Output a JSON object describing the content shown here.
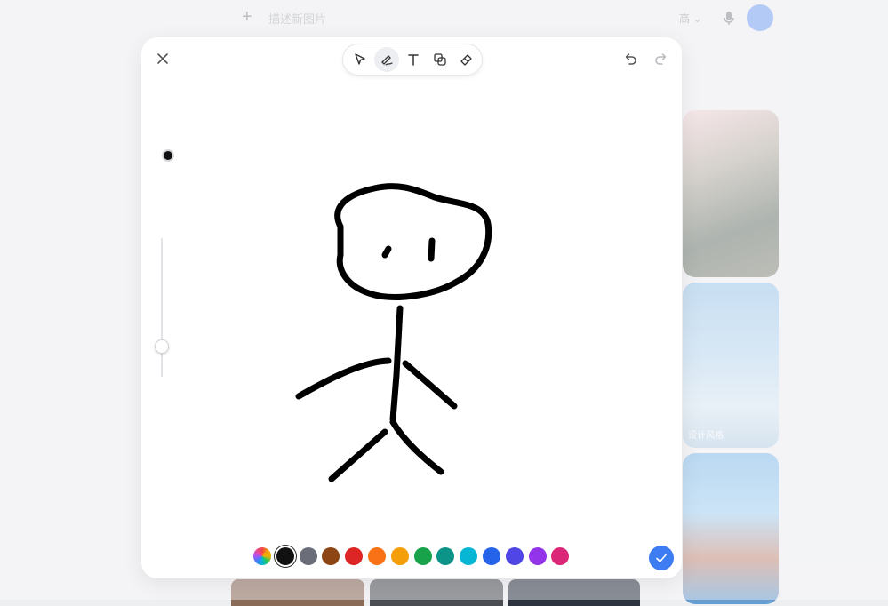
{
  "topbar": {
    "prompt_placeholder": "描述新图片",
    "quality_label": "高",
    "plus_icon": "plus-icon",
    "mic_icon": "microphone-icon",
    "send_icon": "send-icon"
  },
  "gallery": {
    "card2_caption": "设计风格"
  },
  "modal": {
    "tools": [
      {
        "name": "select",
        "icon": "cursor-icon",
        "active": false
      },
      {
        "name": "pen",
        "icon": "pen-icon",
        "active": true
      },
      {
        "name": "text",
        "icon": "text-icon",
        "active": false
      },
      {
        "name": "shapes",
        "icon": "shapes-icon",
        "active": false
      },
      {
        "name": "eraser",
        "icon": "eraser-icon",
        "active": false
      }
    ],
    "brush_color": "#111111",
    "brush_size_level": 0.3,
    "palette": [
      {
        "name": "rainbow",
        "color": "conic"
      },
      {
        "name": "black",
        "color": "#111111",
        "selected": true
      },
      {
        "name": "gray",
        "color": "#6b6e78"
      },
      {
        "name": "brown",
        "color": "#8c4513"
      },
      {
        "name": "red",
        "color": "#dc2626"
      },
      {
        "name": "orange",
        "color": "#f97316"
      },
      {
        "name": "amber",
        "color": "#f59e0b"
      },
      {
        "name": "green",
        "color": "#16a34a"
      },
      {
        "name": "teal",
        "color": "#0d9488"
      },
      {
        "name": "cyan",
        "color": "#06b6d4"
      },
      {
        "name": "blue",
        "color": "#2563eb"
      },
      {
        "name": "indigo",
        "color": "#4f46e5"
      },
      {
        "name": "purple",
        "color": "#9333ea"
      },
      {
        "name": "pink",
        "color": "#db2777"
      }
    ],
    "confirm_icon": "check-icon"
  }
}
